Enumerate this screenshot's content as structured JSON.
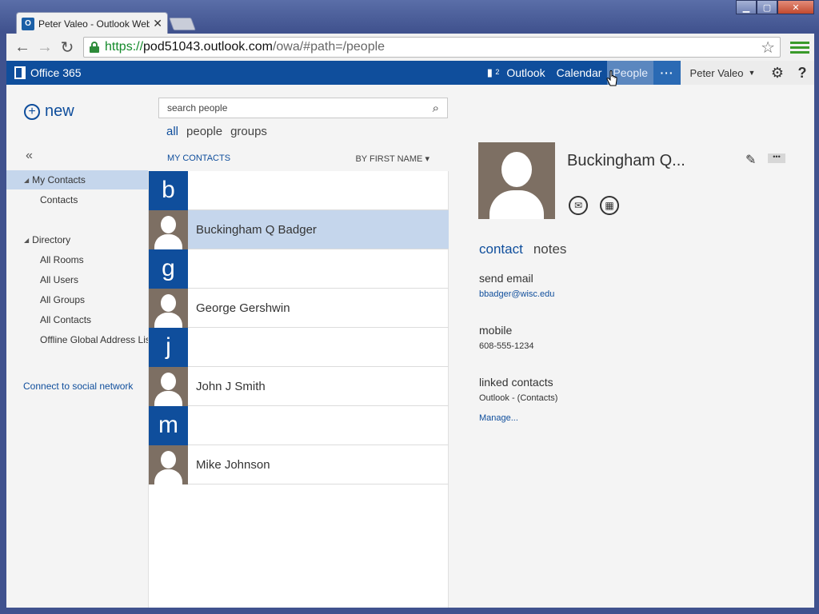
{
  "browser": {
    "tab_title": "Peter Valeo - Outlook Web",
    "tab_favicon": "O",
    "url_secure": "https://",
    "url_host": "pod51043.outlook.com",
    "url_path": "/owa/#path=/people"
  },
  "o365": {
    "brand": "Office 365",
    "notif_count": "2",
    "nav": [
      {
        "label": "Outlook",
        "active": false
      },
      {
        "label": "Calendar",
        "active": false
      },
      {
        "label": "People",
        "active": true
      }
    ],
    "more": "···",
    "user": "Peter Valeo",
    "help": "?"
  },
  "leftnav": {
    "new_label": "new",
    "collapse": "«",
    "folders": [
      {
        "label": "My Contacts",
        "level": 0,
        "expanded": true,
        "selected": true
      },
      {
        "label": "Contacts",
        "level": 1
      },
      {
        "label": "Directory",
        "level": 0,
        "expanded": true
      },
      {
        "label": "All Rooms",
        "level": 1
      },
      {
        "label": "All Users",
        "level": 1
      },
      {
        "label": "All Groups",
        "level": 1
      },
      {
        "label": "All Contacts",
        "level": 1
      },
      {
        "label": "Offline Global Address Lis",
        "level": 1
      }
    ],
    "connect": "Connect to social network"
  },
  "list": {
    "search_placeholder": "search people",
    "filters": [
      "all",
      "people",
      "groups"
    ],
    "section": "MY CONTACTS",
    "sort": "BY FIRST NAME",
    "rows": [
      {
        "type": "letter",
        "text": "b"
      },
      {
        "type": "contact",
        "text": "Buckingham Q Badger",
        "selected": true
      },
      {
        "type": "letter",
        "text": "g"
      },
      {
        "type": "contact",
        "text": "George Gershwin"
      },
      {
        "type": "letter",
        "text": "j"
      },
      {
        "type": "contact",
        "text": "John J Smith"
      },
      {
        "type": "letter",
        "text": "m"
      },
      {
        "type": "contact",
        "text": "Mike Johnson"
      }
    ]
  },
  "detail": {
    "name": "Buckingham Q...",
    "tabs": [
      "contact",
      "notes"
    ],
    "email_label": "send email",
    "email": "bbadger@wisc.edu",
    "mobile_label": "mobile",
    "mobile": "608-555-1234",
    "linked_label": "linked contacts",
    "linked": "Outlook - (Contacts)",
    "manage": "Manage..."
  },
  "colors": {
    "brand_blue": "#0f4e9c",
    "selection": "#c5d6ec",
    "avatar": "#7d6f63"
  }
}
